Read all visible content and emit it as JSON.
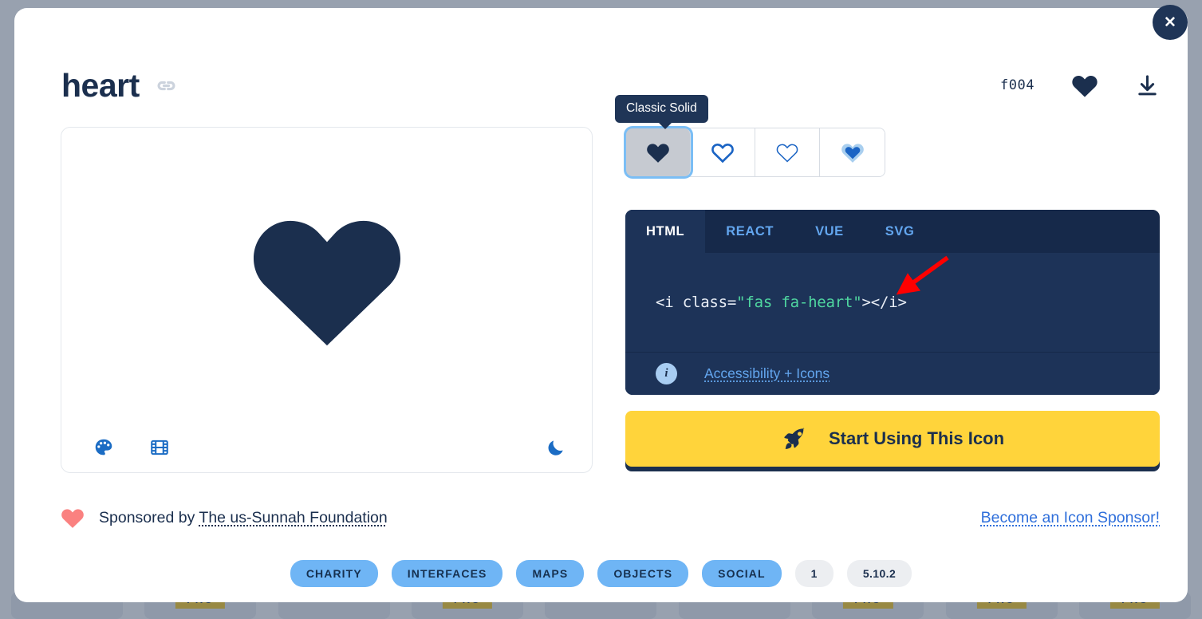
{
  "background": {
    "pro_badge_label": "PRO",
    "pro_positions": [
      1,
      3,
      6,
      7,
      8
    ],
    "card_count": 9
  },
  "modal": {
    "close_label": "✕",
    "header": {
      "icon_name": "heart",
      "link_icon": "link-icon",
      "unicode": "f004",
      "favorite_icon": "heart-filled-icon",
      "download_icon": "download-icon"
    },
    "preview": {
      "glyph": "heart",
      "glyph_color": "#1b2f4e",
      "tools": [
        {
          "name": "palette-icon",
          "title": "Color"
        },
        {
          "name": "film-icon",
          "title": "Animation"
        },
        {
          "name": "moon-icon",
          "title": "Dark mode"
        }
      ]
    },
    "style_picker": {
      "tooltip": "Classic Solid",
      "options": [
        {
          "name": "classic-solid",
          "label": "Classic Solid",
          "selected": true
        },
        {
          "name": "classic-regular",
          "label": "Classic Regular",
          "selected": false
        },
        {
          "name": "classic-light",
          "label": "Classic Light",
          "selected": false
        },
        {
          "name": "duotone",
          "label": "Duotone",
          "selected": false
        }
      ]
    },
    "code": {
      "tabs": [
        {
          "label": "HTML",
          "active": true
        },
        {
          "label": "REACT",
          "active": false
        },
        {
          "label": "VUE",
          "active": false
        },
        {
          "label": "SVG",
          "active": false
        }
      ],
      "snippet_prefix": "<i class=",
      "snippet_string": "\"fas fa-heart\"",
      "snippet_suffix": "></i>",
      "info_icon": "info-icon",
      "accessibility_link": "Accessibility + Icons",
      "annotation": "red-arrow"
    },
    "cta": {
      "icon": "rocket-icon",
      "label": "Start Using This Icon",
      "bg": "#ffd43b",
      "fg": "#1b2f4e"
    },
    "sponsor": {
      "heart_icon": "heart-icon",
      "prefix": "Sponsored by ",
      "name": "The us-Sunnah Foundation",
      "become_sponsor": "Become an Icon Sponsor!"
    },
    "tags": [
      {
        "label": "CHARITY",
        "kind": "category"
      },
      {
        "label": "INTERFACES",
        "kind": "category"
      },
      {
        "label": "MAPS",
        "kind": "category"
      },
      {
        "label": "OBJECTS",
        "kind": "category"
      },
      {
        "label": "SOCIAL",
        "kind": "category"
      },
      {
        "label": "1",
        "kind": "meta"
      },
      {
        "label": "5.10.2",
        "kind": "meta"
      }
    ]
  }
}
